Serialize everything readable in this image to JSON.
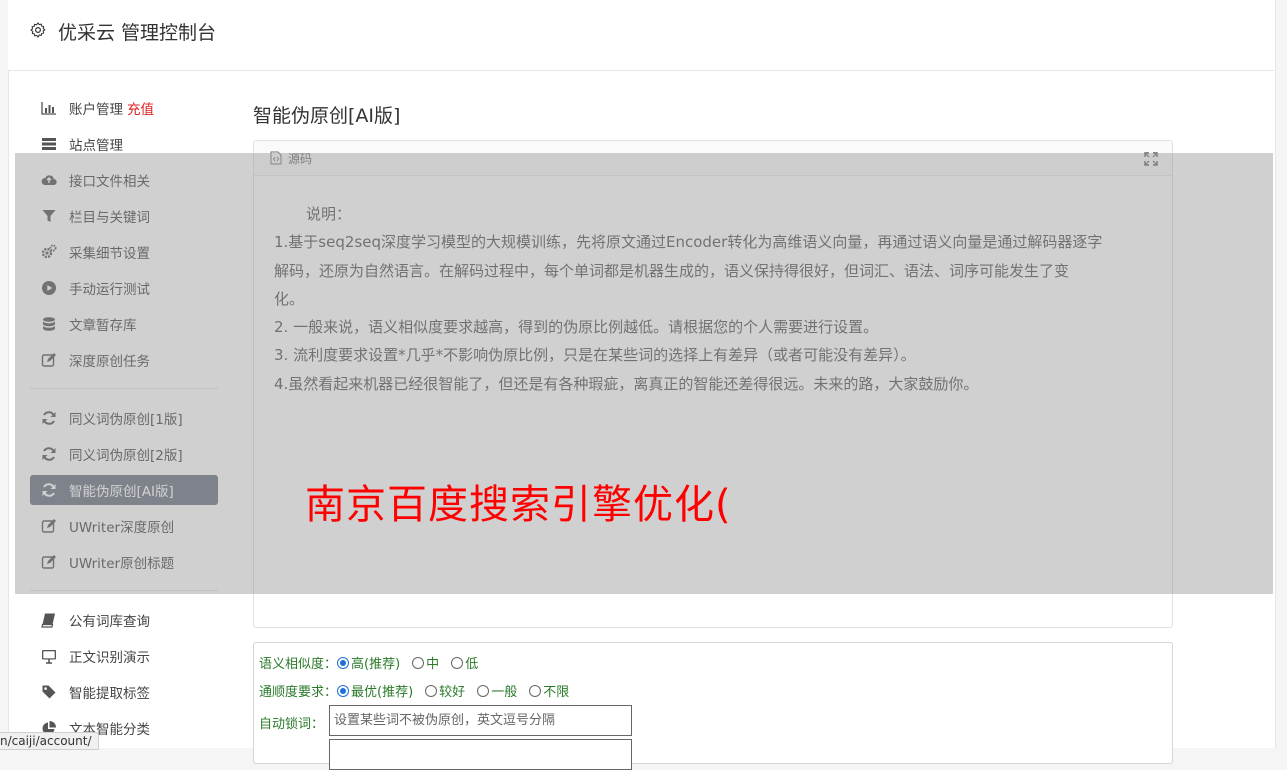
{
  "header": {
    "title": "优采云 管理控制台",
    "icon": "gear-icon"
  },
  "sidebar": {
    "group1": [
      {
        "label": "账户管理",
        "extra": "充值",
        "icon": "bar-chart-icon"
      },
      {
        "label": "站点管理",
        "icon": "server-icon"
      },
      {
        "label": "接口文件相关",
        "icon": "cloud-upload-icon"
      },
      {
        "label": "栏目与关键词",
        "icon": "filter-icon"
      },
      {
        "label": "采集细节设置",
        "icon": "gears-icon"
      },
      {
        "label": "手动运行测试",
        "icon": "play-icon"
      },
      {
        "label": "文章暂存库",
        "icon": "database-icon"
      },
      {
        "label": "深度原创任务",
        "icon": "edit-icon"
      }
    ],
    "group2": [
      {
        "label": "同义词伪原创[1版]",
        "icon": "refresh-icon"
      },
      {
        "label": "同义词伪原创[2版]",
        "icon": "refresh-icon"
      },
      {
        "label": "智能伪原创[AI版]",
        "icon": "refresh-icon",
        "active": true
      },
      {
        "label": "UWriter深度原创",
        "icon": "edit-icon"
      },
      {
        "label": "UWriter原创标题",
        "icon": "edit-icon"
      }
    ],
    "group3": [
      {
        "label": "公有词库查询",
        "icon": "book-icon"
      },
      {
        "label": "正文识别演示",
        "icon": "monitor-icon"
      },
      {
        "label": "智能提取标签",
        "icon": "tag-icon"
      },
      {
        "label": "文本智能分类",
        "icon": "pie-chart-icon"
      }
    ]
  },
  "main": {
    "title": "智能伪原创[AI版]",
    "editor": {
      "source_label": "源码",
      "lines": [
        "说明：",
        "1.基于seq2seq深度学习模型的大规模训练，先将原文通过Encoder转化为高维语义向量，再通过语义向量是通过解码器逐字",
        "解码，还原为自然语言。在解码过程中，每个单词都是机器生成的，语义保持得很好，但词汇、语法、词序可能发生了变",
        "化。",
        "2. 一般来说，语义相似度要求越高，得到的伪原比例越低。请根据您的个人需要进行设置。",
        "3. 流利度要求设置*几乎*不影响伪原比例，只是在某些词的选择上有差异（或者可能没有差异）。",
        "4.虽然看起来机器已经很智能了，但还是有各种瑕疵，离真正的智能还差得很远。未来的路，大家鼓励你。"
      ]
    },
    "watermark": "南京百度搜索引擎优化(",
    "settings": {
      "similarity": {
        "label": "语义相似度：",
        "options": [
          "高(推荐)",
          "中",
          "低"
        ],
        "selected": 0
      },
      "fluency": {
        "label": "通顺度要求：",
        "options": [
          "最优(推荐)",
          "较好",
          "一般",
          "不限"
        ],
        "selected": 0
      },
      "lock": {
        "label": "自动锁词：",
        "placeholder": "设置某些词不被伪原创，英文逗号分隔"
      }
    }
  },
  "statusbar": {
    "url": "n/caiji/account/"
  },
  "colors": {
    "active_bg": "#6b7482",
    "red": "#e02020",
    "green_label": "#2a7a2a",
    "watermark": "#ff0000"
  }
}
